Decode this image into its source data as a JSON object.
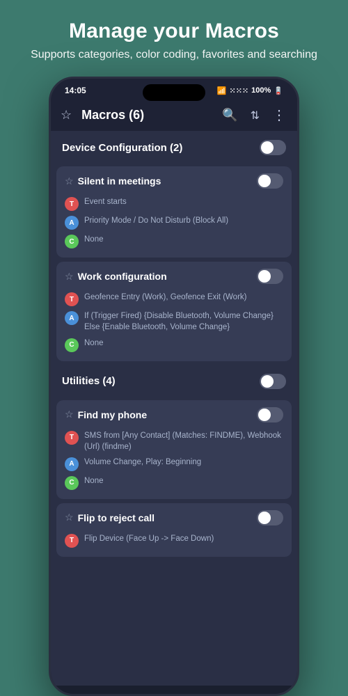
{
  "header": {
    "title": "Manage your Macros",
    "subtitle": "Supports categories, color coding, favorites and searching"
  },
  "statusBar": {
    "time": "14:05",
    "signal": "📶",
    "bars": "ull",
    "battery": "100%"
  },
  "appBar": {
    "starIcon": "☆",
    "title": "Macros (6)",
    "searchIcon": "⌕",
    "collapseIcon": "⌃",
    "moreIcon": "⋮"
  },
  "categories": [
    {
      "id": "device-config",
      "title": "Device Configuration (2)",
      "toggleOn": false,
      "macros": [
        {
          "id": "silent-meetings",
          "title": "Silent in meetings",
          "toggleOn": false,
          "details": [
            {
              "type": "T",
              "text": "Event starts"
            },
            {
              "type": "A",
              "text": "Priority Mode / Do Not Disturb (Block All)"
            },
            {
              "type": "C",
              "text": "None"
            }
          ]
        },
        {
          "id": "work-config",
          "title": "Work configuration",
          "toggleOn": false,
          "details": [
            {
              "type": "T",
              "text": "Geofence Entry (Work), Geofence Exit (Work)"
            },
            {
              "type": "A",
              "text": "If (Trigger Fired) {Disable Bluetooth, Volume Change} Else {Enable Bluetooth, Volume Change}"
            },
            {
              "type": "C",
              "text": "None"
            }
          ]
        }
      ]
    },
    {
      "id": "utilities",
      "title": "Utilities (4)",
      "toggleOn": false,
      "macros": [
        {
          "id": "find-my-phone",
          "title": "Find my phone",
          "toggleOn": false,
          "details": [
            {
              "type": "T",
              "text": "SMS from [Any Contact] (Matches: FINDME), Webhook (Url) (findme)"
            },
            {
              "type": "A",
              "text": "Volume Change, Play: Beginning"
            },
            {
              "type": "C",
              "text": "None"
            }
          ]
        },
        {
          "id": "flip-to-reject",
          "title": "Flip to reject call",
          "toggleOn": false,
          "details": [
            {
              "type": "T",
              "text": "Flip Device (Face Up -> Face Down)"
            }
          ]
        }
      ]
    }
  ]
}
